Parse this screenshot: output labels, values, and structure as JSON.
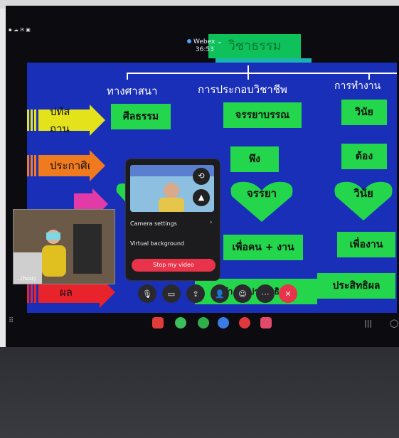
{
  "webex": {
    "app_name": "Webex",
    "timer": "36:53"
  },
  "slide": {
    "title": "วิชาธรรม",
    "columns": [
      "ทางศาสนา",
      "การประกอบวิชาชีพ",
      "การทำงาน"
    ],
    "rows": [
      {
        "label": "ปทัสถาน",
        "cells": [
          "ศีลธรรม",
          "จรรยาบรรณ",
          "วินัย"
        ]
      },
      {
        "label": "ประกาศิต",
        "cells": [
          "",
          "พึง",
          "ต้อง"
        ]
      },
      {
        "label": "",
        "cells": [
          "",
          "จรรยา",
          "วินัย"
        ]
      },
      {
        "label": "",
        "cells": [
          "",
          "เพื่อคน + งาน",
          "เพื่องาน"
        ]
      },
      {
        "label": "ผล",
        "cells": [
          "",
          "",
          "ประสิทธิผล"
        ]
      }
    ],
    "row3_mid_partial": "ทำ  รับ  ประสิทธิผล"
  },
  "participant": {
    "name": "...(host)"
  },
  "camera_popup": {
    "camera_settings": "Camera settings",
    "virtual_background": "Virtual background",
    "stop_video": "Stop my video"
  },
  "controls": [
    "mute-icon",
    "video-icon",
    "share-icon",
    "participants-icon",
    "reactions-icon",
    "more-icon",
    "leave-icon"
  ],
  "colors": {
    "slide_bg": "#1a2fb8",
    "box_green": "#23d64b",
    "leave_red": "#e8334a"
  }
}
